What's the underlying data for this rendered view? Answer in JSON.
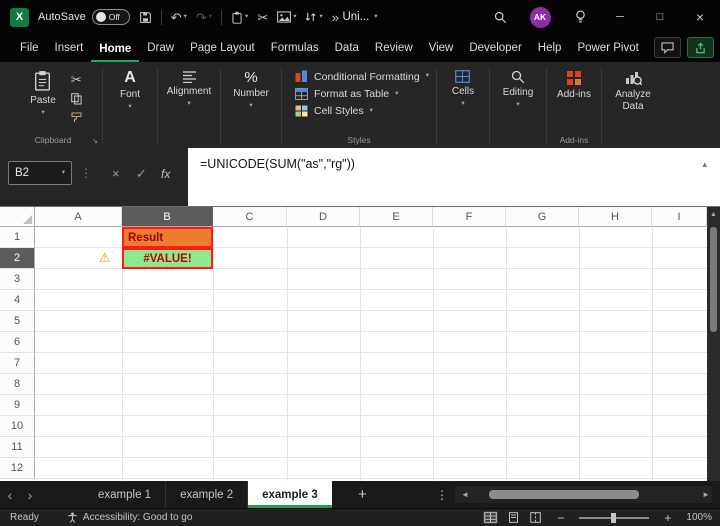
{
  "titlebar": {
    "logo_glyph": "X",
    "autosave_label": "AutoSave",
    "autosave_state": "Off",
    "doc_name": "Uni...",
    "avatar_initials": "AK"
  },
  "menubar": {
    "items": [
      "File",
      "Insert",
      "Home",
      "Draw",
      "Page Layout",
      "Formulas",
      "Data",
      "Review",
      "View",
      "Developer",
      "Help",
      "Power Pivot"
    ],
    "active": "Home"
  },
  "ribbon": {
    "paste": "Paste",
    "clipboard_group": "Clipboard",
    "font": "Font",
    "alignment": "Alignment",
    "number": "Number",
    "conditional_formatting": "Conditional Formatting",
    "format_as_table": "Format as Table",
    "cell_styles": "Cell Styles",
    "styles_group": "Styles",
    "cells": "Cells",
    "editing": "Editing",
    "addins": "Add-ins",
    "addins_group": "Add-ins",
    "analyze_data": "Analyze Data"
  },
  "formula_bar": {
    "name_box": "B2",
    "fx": "fx",
    "formula": "=UNICODE(SUM(\"as\",\"rg\"))"
  },
  "grid": {
    "columns": [
      "A",
      "B",
      "C",
      "D",
      "E",
      "F",
      "G",
      "H",
      "I"
    ],
    "rows": [
      "1",
      "2",
      "3",
      "4",
      "5",
      "6",
      "7",
      "8",
      "9",
      "10",
      "11",
      "12"
    ],
    "selection": {
      "column": "B",
      "row": "2",
      "active_cell": "B2"
    },
    "cells": {
      "B1": "Result",
      "B2": "#VALUE!"
    },
    "colors": {
      "b1_fill": "#ED7D31",
      "b1_text": "#9C0006",
      "b2_fill": "#8FE78F",
      "b2_text": "#C00000",
      "highlight_border": "#FF1A1A",
      "accent_green": "#21A366"
    }
  },
  "sheet_tabs": {
    "tabs": [
      "example 1",
      "example 2",
      "example 3"
    ],
    "active": "example 3"
  },
  "status_bar": {
    "ready": "Ready",
    "accessibility": "Accessibility: Good to go",
    "zoom": "100%"
  },
  "glyphs": {
    "dropdown": "▾",
    "undo": "↶",
    "redo": "↷",
    "cut": "✂",
    "warning": "⚠",
    "overflow": "»",
    "dots": "⋮",
    "cancel": "×",
    "check": "✓",
    "collapse": "▴",
    "minimize": "─",
    "maximize": "□",
    "close": "×",
    "chevron_left": "‹",
    "chevron_right": "›",
    "scroll_left": "◄",
    "scroll_right": "►",
    "scroll_up": "▲",
    "minus": "−",
    "plus": "+",
    "add_sheet": "+",
    "launcher": "↘",
    "percent": "%",
    "font_a": "A"
  }
}
